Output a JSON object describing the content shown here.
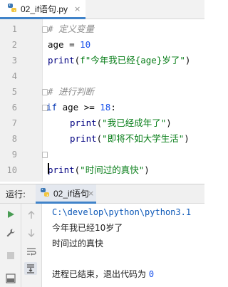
{
  "editor_tab": {
    "file_name": "02_if语句.py",
    "close": "×"
  },
  "gutter": [
    "1",
    "2",
    "3",
    "4",
    "5",
    "6",
    "7",
    "8",
    "9",
    "10"
  ],
  "code": {
    "line1": "# 定义变量",
    "line2_var": "age",
    "line2_op": " = ",
    "line2_num": "10",
    "line3_fn": "print",
    "line3_open": "(",
    "line3_str": "f\"今年我已经{age}岁了\"",
    "line3_close": ")",
    "line5": "# 进行判断",
    "line6_kw": "if",
    "line6_rest": " age >= ",
    "line6_num": "18",
    "line6_colon": ":",
    "line7_fn": "print",
    "line7_open": "(",
    "line7_str": "\"我已经成年了\"",
    "line7_close": ")",
    "line8_fn": "print",
    "line8_open": "(",
    "line8_str": "\"即将不如大学生活\"",
    "line8_close": ")",
    "line10_fn": "print",
    "line10_open": "(",
    "line10_str": "\"时间过的真快\"",
    "line10_close": ")"
  },
  "run_panel": {
    "label": "运行:",
    "tab_name": "02_if语句",
    "close": "×"
  },
  "console": {
    "path": "C:\\develop\\python\\python3.1",
    "out1": "今年我已经10岁了",
    "out2": "时间过的真快",
    "exit_text": "进程已结束，退出代码为 ",
    "exit_code": "0"
  },
  "icons": {
    "python_file": "python-file-icon",
    "run": "run-icon",
    "wrench": "wrench-icon",
    "stop": "stop-icon",
    "up": "arrow-up-icon",
    "down": "arrow-down-icon",
    "soft_wrap": "soft-wrap-icon",
    "scroll_end": "scroll-to-end-icon"
  },
  "colors": {
    "accent": "#4083c9",
    "keyword": "#0033b3",
    "string": "#067d17",
    "number": "#1750eb",
    "comment": "#8c8c8c"
  }
}
